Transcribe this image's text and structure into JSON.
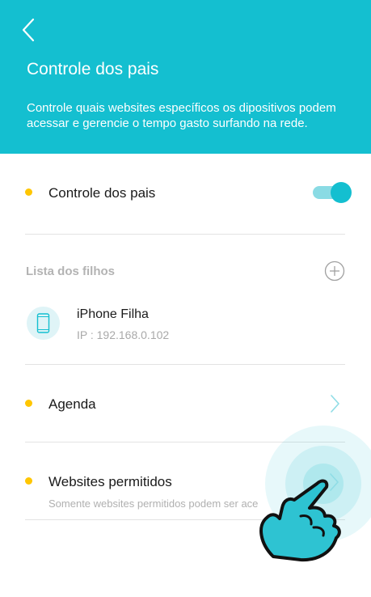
{
  "header": {
    "title": "Controle dos pais",
    "description": "Controle quais websites específicos os dipositivos podem acessar e gerencie o tempo gasto surfando na rede.",
    "background_color": "#14bfd0"
  },
  "parental_control": {
    "label": "Controle dos pais",
    "toggle_on": true
  },
  "children_list": {
    "label": "Lista dos filhos",
    "devices": [
      {
        "name": "iPhone Filha",
        "ip": "IP : 192.168.0.102",
        "icon": "smartphone-icon"
      }
    ]
  },
  "schedule": {
    "label": "Agenda"
  },
  "allowed_websites": {
    "label": "Websites permitidos",
    "description": "Somente websites permitidos podem ser ace"
  },
  "colors": {
    "accent": "#14bfd0",
    "bullet": "#ffc600",
    "divider": "#e3e3e3"
  },
  "icons": [
    "back-arrow-icon",
    "plus-circle-icon",
    "smartphone-icon",
    "chevron-right-icon",
    "pointing-hand-icon"
  ]
}
